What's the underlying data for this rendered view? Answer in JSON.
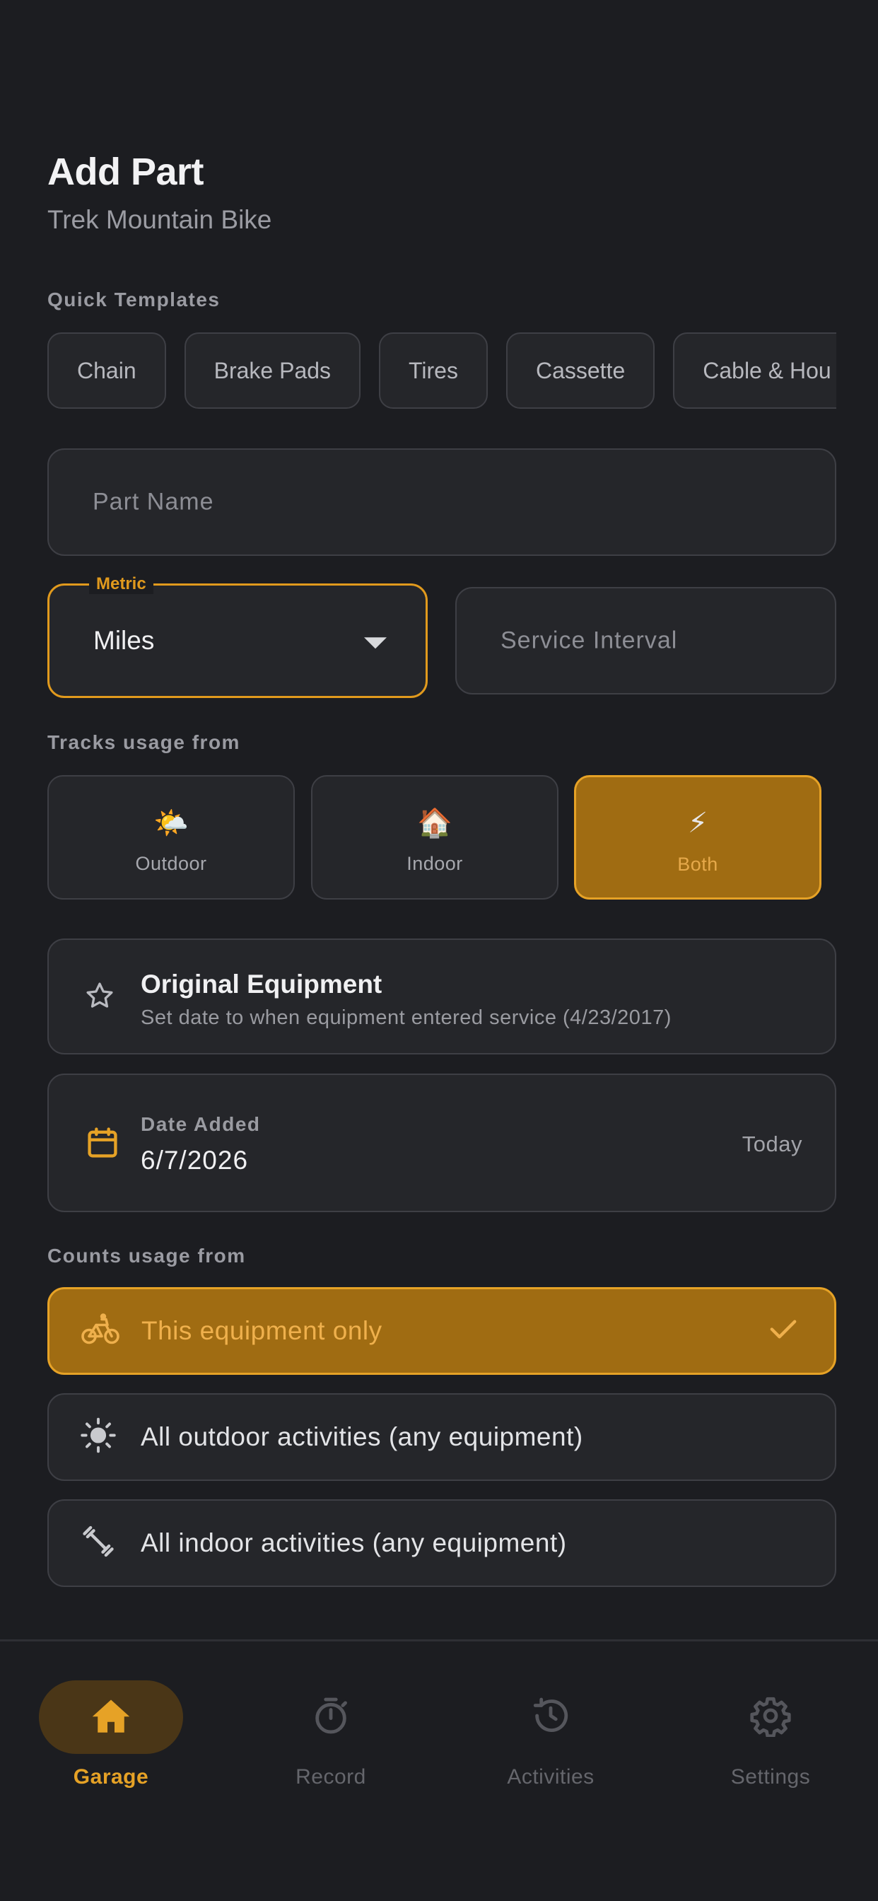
{
  "header": {
    "title": "Add Part",
    "subtitle": "Trek Mountain Bike"
  },
  "templates": {
    "label": "Quick Templates",
    "items": [
      "Chain",
      "Brake Pads",
      "Tires",
      "Cassette",
      "Cable & Hou"
    ]
  },
  "form": {
    "part_name_placeholder": "Part Name",
    "metric": {
      "label": "Metric",
      "value": "Miles"
    },
    "service_interval_placeholder": "Service Interval"
  },
  "tracks": {
    "label": "Tracks usage from",
    "items": [
      {
        "emoji": "🌤️",
        "label": "Outdoor"
      },
      {
        "emoji": "🏠",
        "label": "Indoor"
      },
      {
        "emoji": "⚡",
        "label": "Both"
      }
    ],
    "selected": "Both"
  },
  "original_equipment": {
    "title": "Original Equipment",
    "subtitle": "Set date to when equipment entered service (4/23/2017)"
  },
  "date_added": {
    "label": "Date Added",
    "value": "6/7/2026",
    "action": "Today"
  },
  "counts": {
    "label": "Counts usage from",
    "options": [
      {
        "label": "This equipment only",
        "icon": "bike-icon"
      },
      {
        "label": "All outdoor activities (any equipment)",
        "icon": "sun-icon"
      },
      {
        "label": "All indoor activities (any equipment)",
        "icon": "dumbbell-icon"
      }
    ],
    "selected": "This equipment only"
  },
  "nav": {
    "items": [
      {
        "label": "Garage",
        "icon": "home-icon"
      },
      {
        "label": "Record",
        "icon": "stopwatch-icon"
      },
      {
        "label": "Activities",
        "icon": "history-icon"
      },
      {
        "label": "Settings",
        "icon": "gear-icon"
      }
    ],
    "active": "Garage"
  },
  "colors": {
    "background": "#1c1d21",
    "card": "#25262a",
    "accent": "#e6a226",
    "accent_fill": "#a06c12"
  }
}
